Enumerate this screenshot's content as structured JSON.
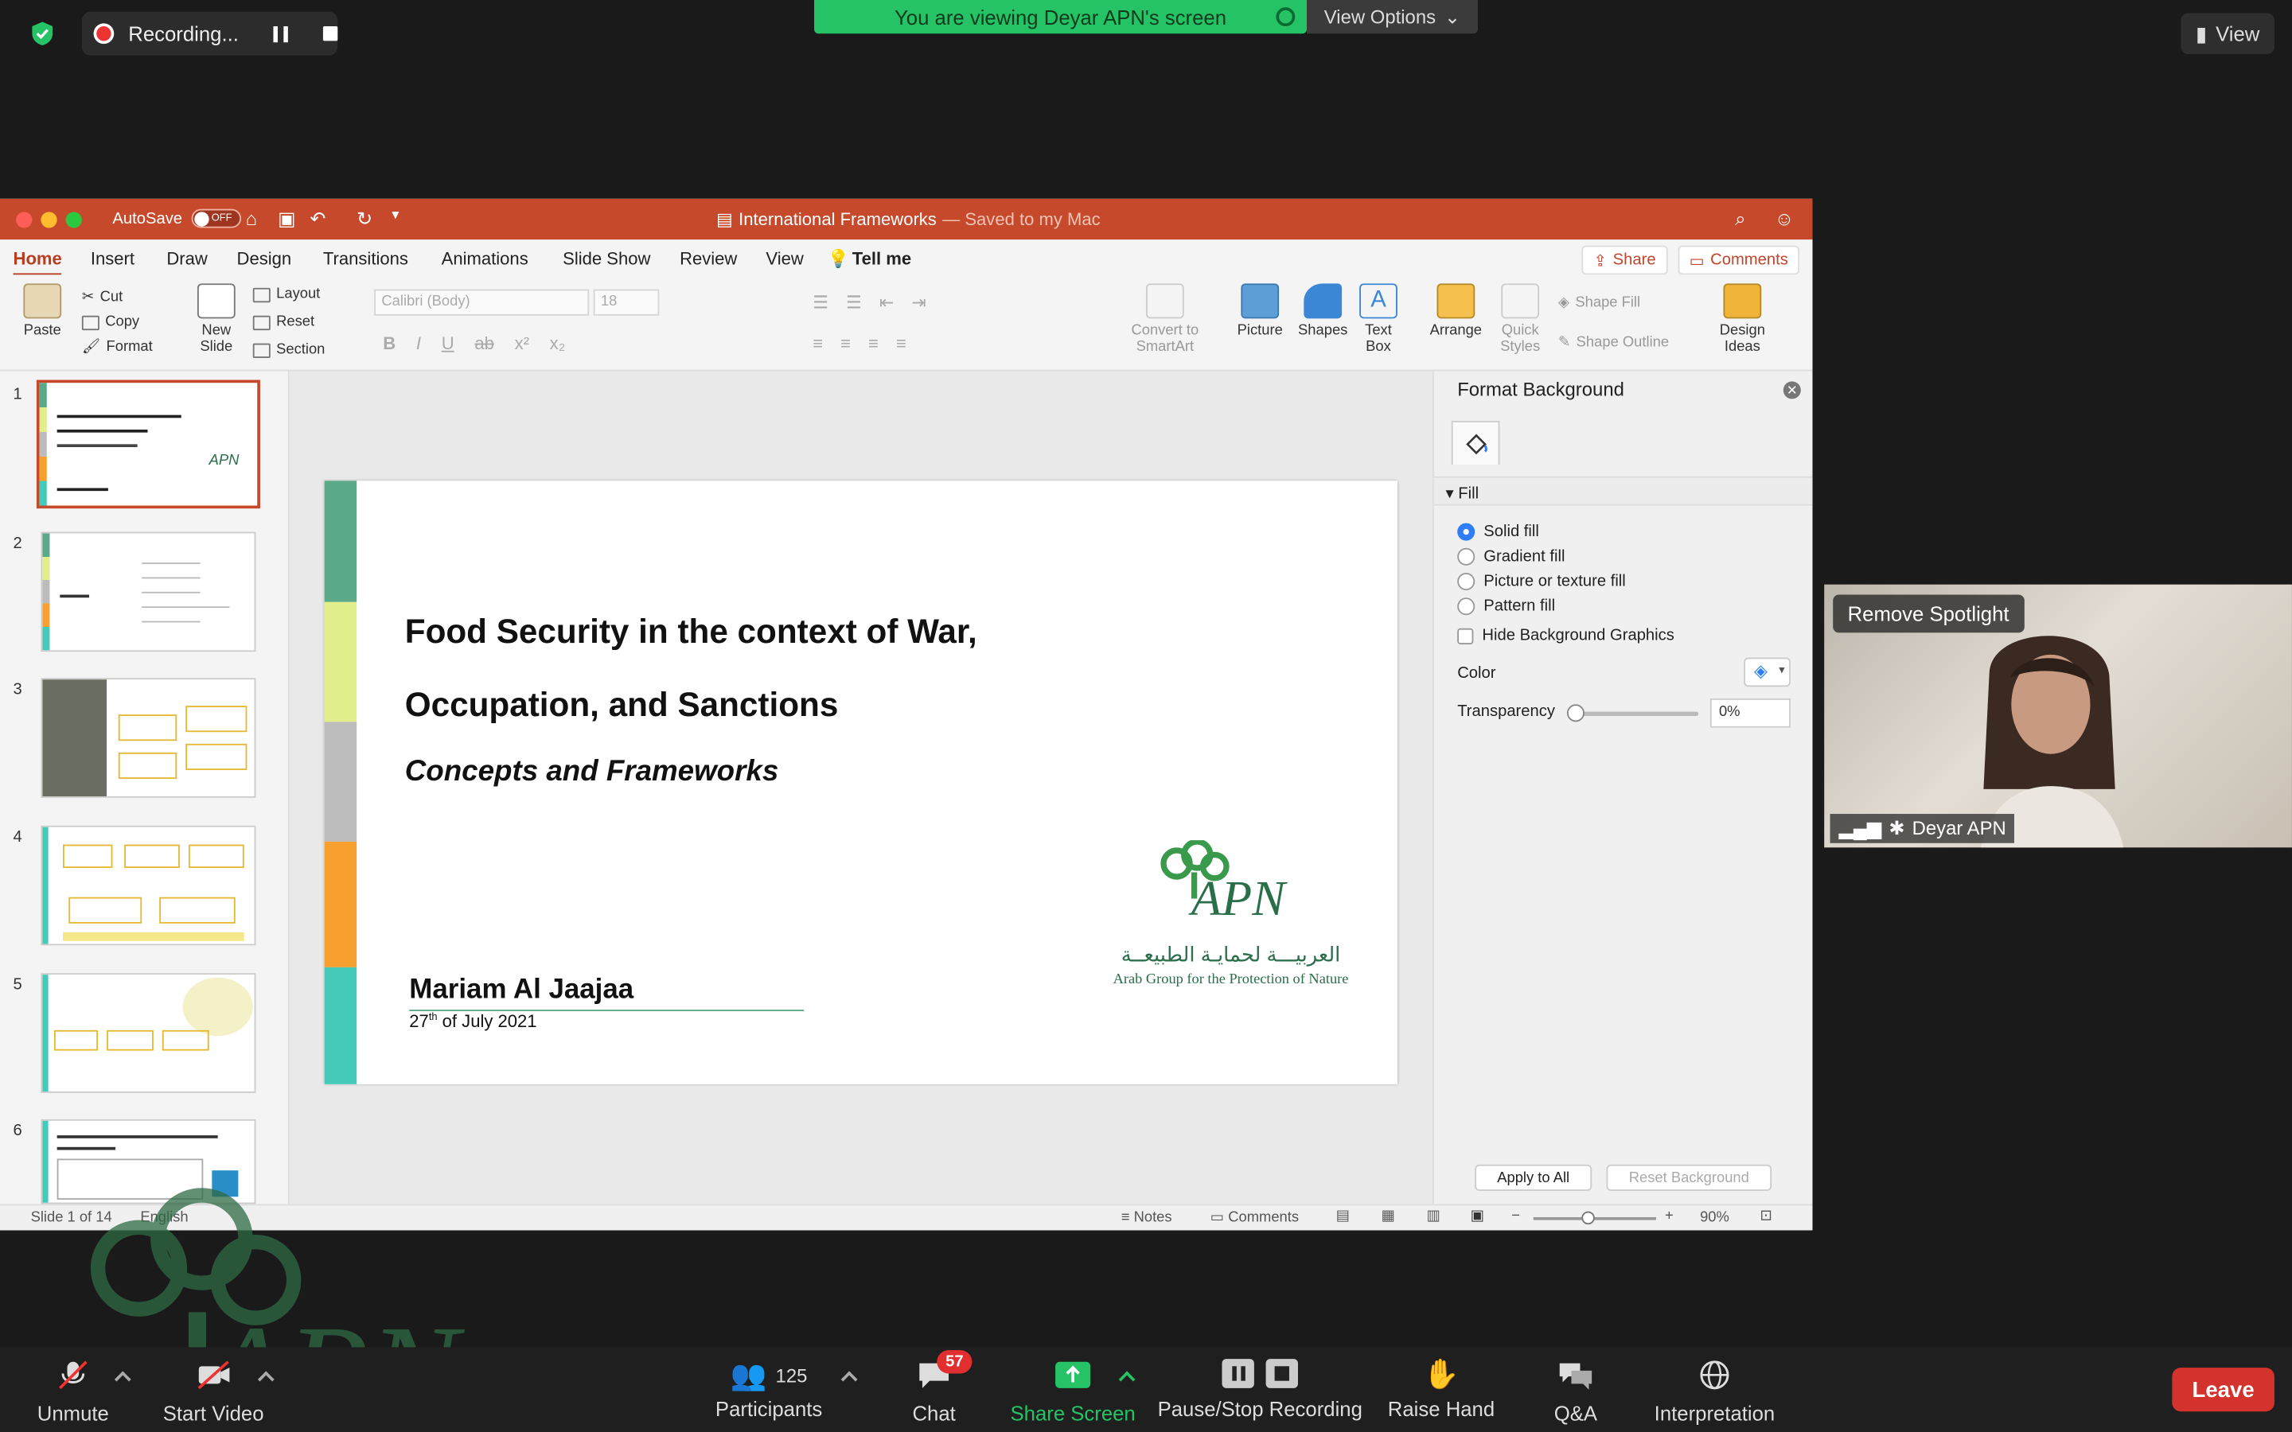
{
  "zoom": {
    "recording_label": "Recording...",
    "banner": "You are viewing Deyar APN's screen",
    "view_options": "View Options",
    "view": "View",
    "spotlight": "Remove Spotlight",
    "participant_name": "Deyar APN",
    "toolbar": {
      "unmute": "Unmute",
      "start_video": "Start Video",
      "participants": "Participants",
      "participants_count": "125",
      "chat": "Chat",
      "chat_badge": "57",
      "share_screen": "Share Screen",
      "pause_stop": "Pause/Stop Recording",
      "raise_hand": "Raise Hand",
      "qa": "Q&A",
      "interpretation": "Interpretation",
      "leave": "Leave"
    }
  },
  "ppt": {
    "autosave": "AutoSave",
    "autosave_state": "OFF",
    "doc_title": "International Frameworks",
    "doc_saved": "— Saved to my Mac",
    "tabs": [
      "Home",
      "Insert",
      "Draw",
      "Design",
      "Transitions",
      "Animations",
      "Slide Show",
      "Review",
      "View",
      "Tell me"
    ],
    "share": "Share",
    "comments": "Comments",
    "ribbon": {
      "paste": "Paste",
      "cut": "Cut",
      "copy": "Copy",
      "format": "Format",
      "new_slide_1": "New",
      "new_slide_2": "Slide",
      "layout": "Layout",
      "reset": "Reset",
      "section": "Section",
      "font_name": "Calibri (Body)",
      "font_size": "18",
      "convert_1": "Convert to",
      "convert_2": "SmartArt",
      "picture": "Picture",
      "shapes": "Shapes",
      "text_box_1": "Text",
      "text_box_2": "Box",
      "arrange": "Arrange",
      "quick_styles_1": "Quick",
      "quick_styles_2": "Styles",
      "shape_fill": "Shape Fill",
      "shape_outline": "Shape Outline",
      "design_ideas_1": "Design",
      "design_ideas_2": "Ideas"
    },
    "thumbnails": [
      "1",
      "2",
      "3",
      "4",
      "5",
      "6"
    ],
    "slide": {
      "title_line1": "Food Security in the context of  War,",
      "title_line2": "Occupation, and Sanctions",
      "subtitle": "Concepts and Frameworks",
      "author": "Mariam Al Jaajaa",
      "date_pre": "27",
      "date_sup": "th",
      "date_post": " of July 2021",
      "logo_text": "APN",
      "logo_arabic": "العربيـــة لحمايـة الطبيعــة",
      "logo_english": "Arab Group for the Protection of Nature"
    },
    "pane": {
      "title": "Format Background",
      "section": "Fill",
      "solid": "Solid fill",
      "gradient": "Gradient fill",
      "picture": "Picture or texture fill",
      "pattern": "Pattern fill",
      "hide": "Hide Background Graphics",
      "color": "Color",
      "transparency": "Transparency",
      "transparency_value": "0%",
      "apply_all": "Apply to All",
      "reset_bg": "Reset Background"
    },
    "status": {
      "slide_of": "Slide 1 of 14",
      "language": "English",
      "notes": "Notes",
      "comments": "Comments",
      "zoom": "90%"
    }
  },
  "colors": {
    "ppt_accent": "#c6492b",
    "zoom_green": "#25c365",
    "leave_red": "#d4322c",
    "apn_green": "#2a6e4a"
  }
}
